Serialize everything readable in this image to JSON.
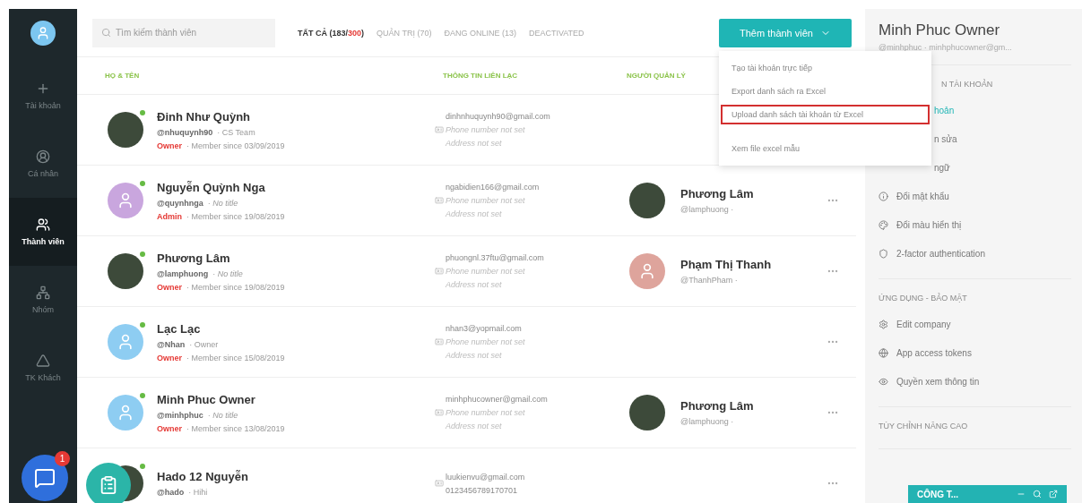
{
  "sidebar": {
    "items": [
      {
        "label": "Tài khoản",
        "selected": false
      },
      {
        "label": "Cá nhân",
        "selected": false
      },
      {
        "label": "Thành viên",
        "selected": true
      },
      {
        "label": "Nhóm",
        "selected": false
      },
      {
        "label": "TK Khách",
        "selected": false
      }
    ],
    "chat_badge": "1"
  },
  "search": {
    "placeholder": "Tìm kiếm thành viên"
  },
  "tabs": [
    {
      "before": "TẤT CẢ (183/",
      "highlight": "300",
      "after": ")",
      "selected": true
    },
    {
      "before": "QUẢN TRỊ (70)",
      "selected": false
    },
    {
      "before": "ĐANG ONLINE (13)",
      "selected": false
    },
    {
      "before": "DEACTIVATED",
      "selected": false
    }
  ],
  "add_button": {
    "label": "Thêm thành viên"
  },
  "menu": [
    {
      "label": "Tạo tài khoản trực tiếp",
      "selected": false
    },
    {
      "label": "Export danh sách ra Excel",
      "selected": false
    },
    {
      "label": "Upload danh sách tài khoản từ Excel",
      "selected": true
    },
    {
      "label": "Xem file excel mẫu",
      "selected": false
    }
  ],
  "table": {
    "columns": [
      "HỌ & TÊN",
      "THÔNG TIN LIÊN LẠC",
      "NGƯỜI QUẢN LÝ"
    ],
    "rows": [
      {
        "name": "Đinh Như Quỳnh",
        "avatar": {
          "kind": "photo"
        },
        "online": true,
        "handle": "@nhuquynh90",
        "title": "· CS Team",
        "title_missing": false,
        "role": "Owner",
        "since": "· Member since 03/09/2019",
        "email": "dinhnhuquynh90@gmail.com",
        "phone": "Phone number not set",
        "phone_missing": true,
        "address": "Address not set",
        "manager": null
      },
      {
        "name": "Nguyễn Quỳnh Nga",
        "avatar": {
          "kind": "default",
          "color": "#c9a6de"
        },
        "online": true,
        "handle": "@quynhnga",
        "title": "· No title",
        "title_missing": true,
        "role": "Admin",
        "since": "· Member since 19/08/2019",
        "email": "ngabidien166@gmail.com",
        "phone": "Phone number not set",
        "phone_missing": true,
        "address": "Address not set",
        "manager": {
          "name": "Phương Lâm",
          "handle": "@lamphuong ·",
          "avatar": {
            "kind": "photo"
          }
        }
      },
      {
        "name": "Phương Lâm",
        "avatar": {
          "kind": "photo"
        },
        "online": true,
        "handle": "@lamphuong",
        "title": "· No title",
        "title_missing": true,
        "role": "Owner",
        "since": "· Member since 19/08/2019",
        "email": "phuongnl.37ftu@gmail.com",
        "phone": "Phone number not set",
        "phone_missing": true,
        "address": "Address not set",
        "manager": {
          "name": "Phạm Thị Thanh",
          "handle": "@ThanhPham ·",
          "avatar": {
            "kind": "default",
            "color": "#dea49c"
          }
        }
      },
      {
        "name": "Lạc Lạc",
        "avatar": {
          "kind": "default",
          "color": "#8ecdf2"
        },
        "online": true,
        "handle": "@Nhan",
        "title": "· Owner",
        "title_missing": false,
        "role": "Owner",
        "since": "· Member since 15/08/2019",
        "email": "nhan3@yopmail.com",
        "phone": "Phone number not set",
        "phone_missing": true,
        "address": "Address not set",
        "manager": null
      },
      {
        "name": "Minh Phuc Owner",
        "avatar": {
          "kind": "default",
          "color": "#8ecdf2"
        },
        "online": true,
        "handle": "@minhphuc",
        "title": "· No title",
        "title_missing": true,
        "role": "Owner",
        "since": "· Member since 13/08/2019",
        "email": "minhphucowner@gmail.com",
        "phone": "Phone number not set",
        "phone_missing": true,
        "address": "Address not set",
        "manager": {
          "name": "Phương Lâm",
          "handle": "@lamphuong ·",
          "avatar": {
            "kind": "photo"
          }
        }
      },
      {
        "name": "Hado 12 Nguyễn",
        "avatar": {
          "kind": "photo"
        },
        "online": true,
        "handle": "@hado",
        "title": "· Hihi",
        "title_missing": false,
        "email": "luukienvu@gmail.com",
        "phone": "0123456789170701",
        "phone_missing": false,
        "manager": null
      }
    ]
  },
  "profile": {
    "name": "Minh Phuc Owner",
    "subtitle": "@minhphuc · minhphucowner@gm...",
    "sections": [
      {
        "title": "N TÀI KHOẢN",
        "kind": "partial",
        "items": [
          {
            "label": "hoản",
            "kind": "partial",
            "selected": true
          },
          {
            "label": "n sửa",
            "kind": "partial",
            "selected": false
          },
          {
            "label": "ngữ",
            "kind": "partial",
            "selected": false
          },
          {
            "label": "Đổi mật khẩu",
            "kind": "full",
            "selected": false
          },
          {
            "label": "Đổi màu hiển thị",
            "kind": "full",
            "selected": false
          },
          {
            "label": "2-factor authentication",
            "kind": "full",
            "selected": false
          }
        ]
      },
      {
        "title": "ỨNG DỤNG - BẢO MẬT",
        "kind": "full",
        "items": [
          {
            "label": "Edit company",
            "kind": "full",
            "selected": false
          },
          {
            "label": "App access tokens",
            "kind": "full",
            "selected": false
          },
          {
            "label": "Quyền xem thông tin",
            "kind": "full",
            "selected": false
          }
        ]
      },
      {
        "title": "TÙY CHỈNH NÂNG CAO",
        "kind": "full"
      }
    ]
  },
  "company_bar": {
    "label": "CÔNG T..."
  }
}
